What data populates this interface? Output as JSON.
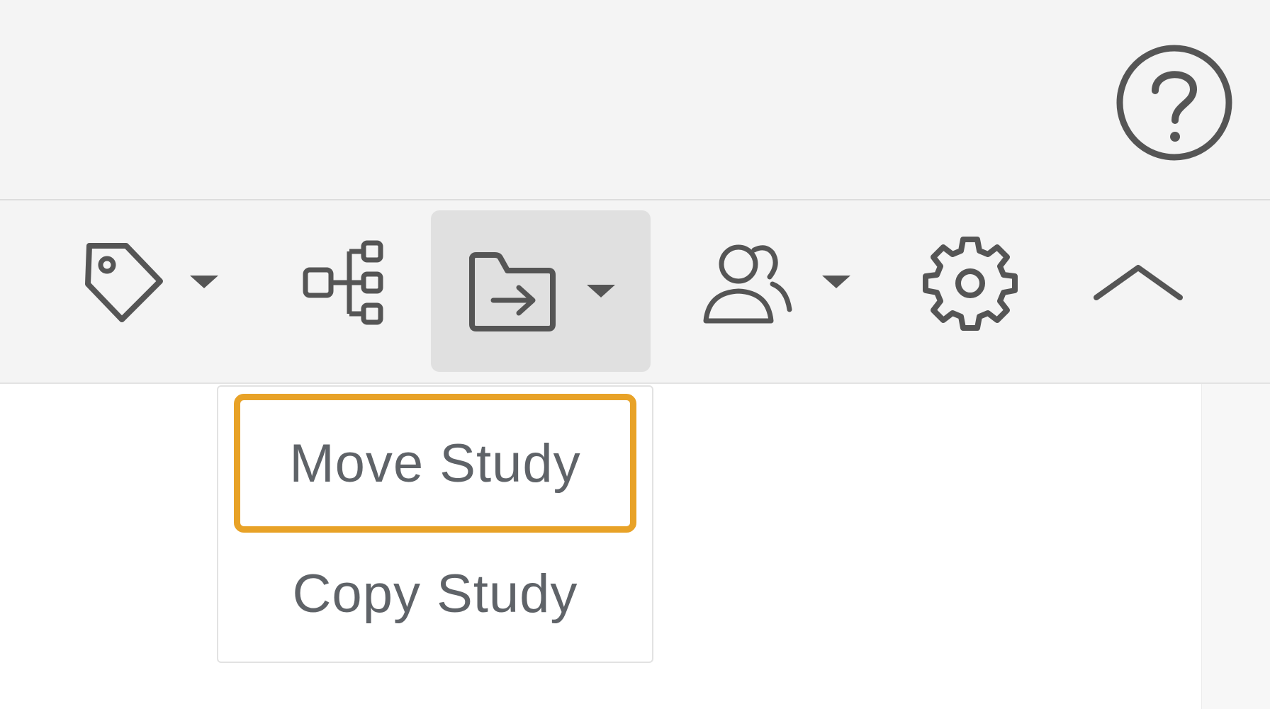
{
  "header": {
    "help_icon": "question-circle-icon"
  },
  "toolbar": {
    "tools": [
      {
        "icon": "tag-icon",
        "has_dropdown": true
      },
      {
        "icon": "hierarchy-icon",
        "has_dropdown": false
      },
      {
        "icon": "folder-move-icon",
        "has_dropdown": true,
        "active": true
      },
      {
        "icon": "users-icon",
        "has_dropdown": true
      },
      {
        "icon": "gear-icon",
        "has_dropdown": false
      },
      {
        "icon": "chevron-up-icon",
        "has_dropdown": false
      }
    ]
  },
  "dropdown": {
    "items": [
      {
        "label": "Move Study",
        "highlighted": true
      },
      {
        "label": "Copy Study",
        "highlighted": false
      }
    ]
  },
  "colors": {
    "highlight": "#e8a227",
    "icon": "#555555",
    "text": "#5f6368",
    "bar_bg": "#f4f4f4",
    "active_bg": "#e0e0e0"
  }
}
